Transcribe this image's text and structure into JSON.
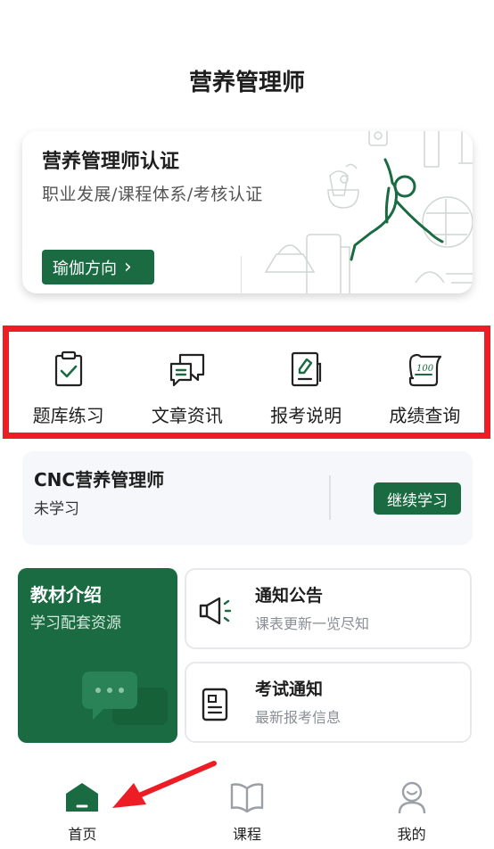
{
  "header": {
    "title": "营养管理师"
  },
  "banner": {
    "title": "营养管理师认证",
    "subtitle": "职业发展/课程体系/考核认证",
    "button_label": "瑜伽方向",
    "button_chevron": "›"
  },
  "quick_nav": {
    "items": [
      {
        "label": "题库练习",
        "icon": "clipboard-check-icon"
      },
      {
        "label": "文章资讯",
        "icon": "chat-bubbles-icon"
      },
      {
        "label": "报考说明",
        "icon": "document-pen-icon"
      },
      {
        "label": "成绩查询",
        "icon": "score-scroll-icon"
      }
    ],
    "score_text": "100"
  },
  "course": {
    "name": "CNC营养管理师",
    "status": "未学习",
    "button_label": "继续学习"
  },
  "material": {
    "title": "教材介绍",
    "subtitle": "学习配套资源"
  },
  "notice": {
    "title": "通知公告",
    "subtitle": "课表更新一览尽知",
    "icon": "megaphone-icon"
  },
  "exam": {
    "title": "考试通知",
    "subtitle": "最新报考信息",
    "icon": "exam-document-icon"
  },
  "tab_bar": {
    "tabs": [
      {
        "label": "首页",
        "icon": "home-icon",
        "active": true
      },
      {
        "label": "课程",
        "icon": "book-icon",
        "active": false
      },
      {
        "label": "我的",
        "icon": "user-icon",
        "active": false
      }
    ]
  },
  "colors": {
    "brand_green": "#1a6a42",
    "highlight_red": "#ee1c25",
    "card_bg": "#f5f7fa"
  }
}
